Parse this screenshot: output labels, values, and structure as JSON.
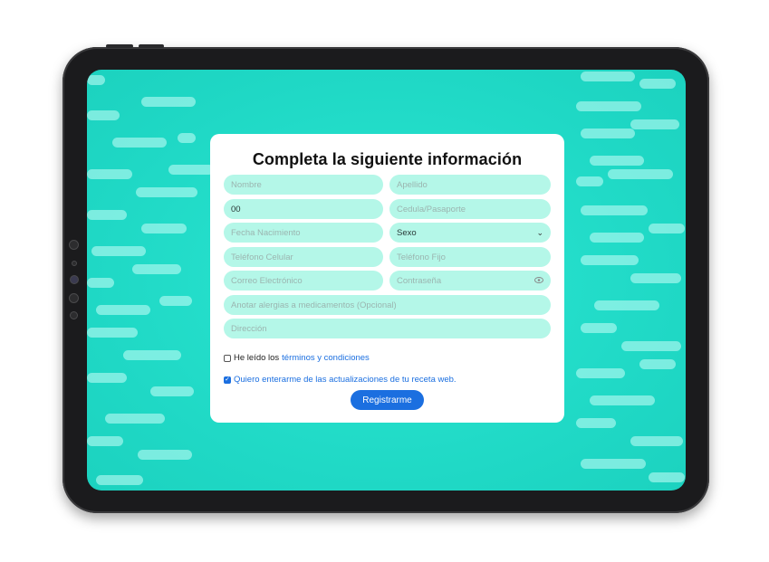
{
  "form": {
    "title": "Completa la siguiente información",
    "fields": {
      "nombre": {
        "placeholder": "Nombre",
        "value": ""
      },
      "apellido": {
        "placeholder": "Apellido",
        "value": ""
      },
      "cedula_prefix": {
        "value": "00"
      },
      "cedula": {
        "placeholder": "Cedula/Pasaporte",
        "value": ""
      },
      "fecha_nacimiento": {
        "placeholder": "Fecha Nacimiento",
        "value": ""
      },
      "sexo": {
        "selected": "Sexo"
      },
      "telefono_celular": {
        "placeholder": "Teléfono Celular",
        "value": ""
      },
      "telefono_fijo": {
        "placeholder": "Teléfono Fijo",
        "value": ""
      },
      "correo": {
        "placeholder": "Correo Electrónico",
        "value": ""
      },
      "contrasena": {
        "placeholder": "Contraseña",
        "value": ""
      },
      "alergias": {
        "placeholder": "Anotar alergias a medicamentos (Opcional)",
        "value": ""
      },
      "direccion": {
        "placeholder": "Dirección",
        "value": ""
      }
    },
    "terms": {
      "text": "He leído los",
      "link": "términos y condiciones",
      "checked": false
    },
    "newsletter": {
      "text": "Quiero enterarme de las actualizaciones de tu receta web.",
      "checked": true
    },
    "submit_label": "Registrarme"
  },
  "colors": {
    "background": "#20ddc9",
    "field": "#b4f7e8",
    "accent": "#1b6fe0"
  },
  "icons": {
    "select": "chevron-down-icon",
    "password": "eye-icon",
    "checkbox": "check-icon"
  }
}
